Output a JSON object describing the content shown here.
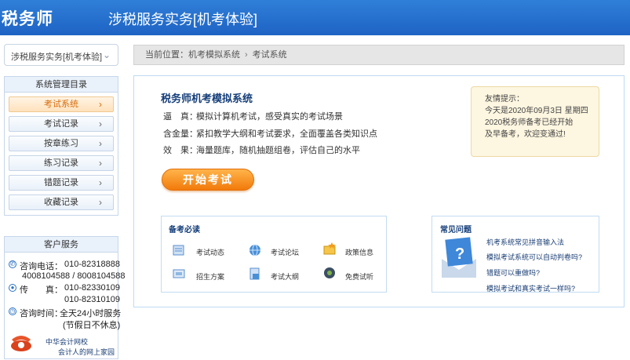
{
  "header": {
    "brand": "税务师",
    "title": "涉税服务实务[机考体验]"
  },
  "subject_select": {
    "value": "涉税服务实务[机考体验]"
  },
  "system_menu": {
    "heading": "系统管理目录",
    "items": [
      {
        "label": "考试系统",
        "active": true
      },
      {
        "label": "考试记录",
        "active": false
      },
      {
        "label": "按章练习",
        "active": false
      },
      {
        "label": "练习记录",
        "active": false
      },
      {
        "label": "错题记录",
        "active": false
      },
      {
        "label": "收藏记录",
        "active": false
      }
    ]
  },
  "customer_service": {
    "heading": "客户服务",
    "phone_label": "咨询电话：",
    "phone1": "010-82318888",
    "phone2": "4008104588 / 8008104588",
    "fax_label": "传　　真：",
    "fax1": "010-82330109",
    "fax2": "010-82310109",
    "time_label": "咨询时间：",
    "time_value": "全天24小时服务",
    "time_note": "(节假日不休息)",
    "brand_line1": "中华会计网校",
    "brand_line2": "会计人的网上家园"
  },
  "breadcrumb": {
    "prefix": "当前位置：",
    "crumb1": "机考模拟系统",
    "crumb2": "考试系统"
  },
  "main": {
    "title": "税务师机考模拟系统",
    "features": [
      {
        "key": "逼　真：",
        "value": "模拟计算机考试，感受真实的考试场景"
      },
      {
        "key": "含金量：",
        "value": "紧扣教学大纲和考试要求，全面覆盖各类知识点"
      },
      {
        "key": "效　果：",
        "value": "海量题库，随机抽题组卷，评估自己的水平"
      }
    ],
    "start_button": "开始考试",
    "note": {
      "line1": "友情提示：",
      "line2": "今天是2020年09月3日 星期四",
      "line3": "2020税务师备考已经开始",
      "line4": "及早备考，欢迎变通过!"
    }
  },
  "prep": {
    "title": "备考必读",
    "links": [
      "考试动态",
      "考试论坛",
      "政策信息",
      "招生方案",
      "考试大纲",
      "免费试听"
    ]
  },
  "faq": {
    "title": "常见问题",
    "links": [
      "机考系统常见拼音输入法",
      "模拟考试系统可以自动判卷吗?",
      "错题可以重做吗?",
      "模拟考试和真实考试一样吗?"
    ]
  },
  "colors": {
    "header": "#1e63c4",
    "accent_orange": "#f27a0b",
    "panel_border": "#c7d6ea"
  }
}
